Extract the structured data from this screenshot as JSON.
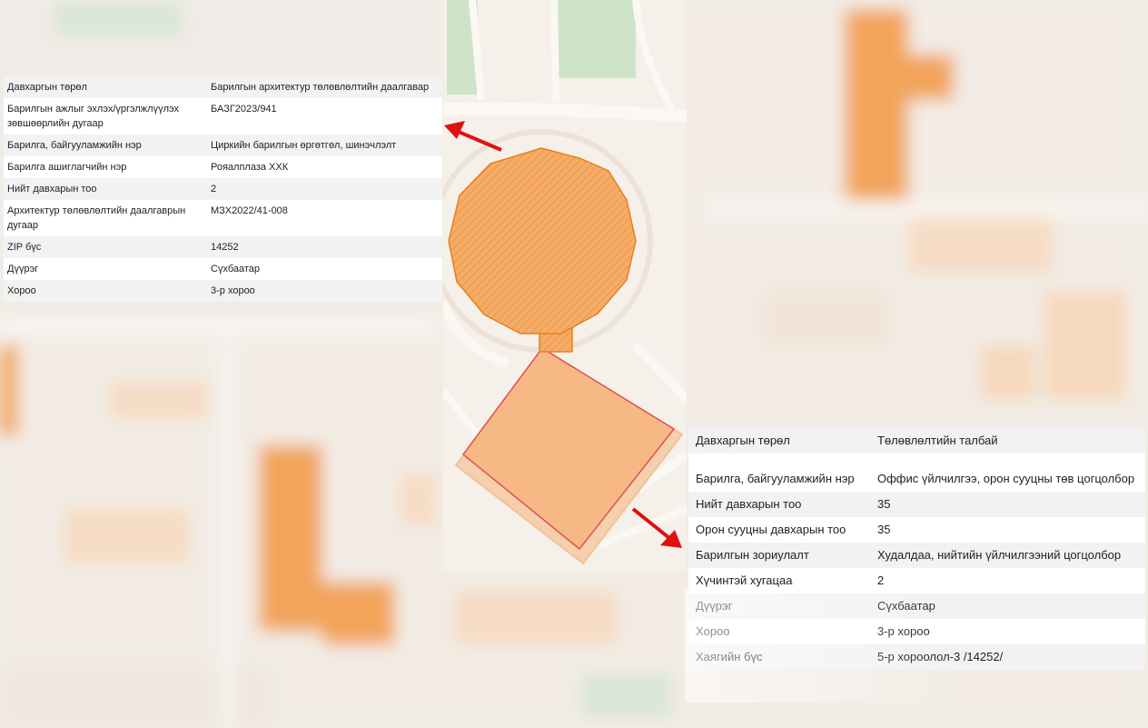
{
  "colors": {
    "building": "#f5a55a",
    "building_outline": "#e8801c",
    "site_outline": "#e05050",
    "arrow": "#e01010",
    "park": "#cfe3c9",
    "road": "#fbf8f4"
  },
  "left_table": {
    "rows": [
      {
        "key": "Давхаргын төрөл",
        "value": "Барилгын архитектур төлөвлөлтийн даалгавар"
      },
      {
        "key": "Барилгын ажлыг эхлэх/үргэлжлүүлэх зөвшөөрлийн дугаар",
        "value": "БАЗГ2023/941"
      },
      {
        "key": "Барилга, байгууламжийн нэр",
        "value": "Циркийн барилгын өргөтгөл, шинэчлэлт"
      },
      {
        "key": "Барилга ашиглагчийн нэр",
        "value": "Рояалплаза ХХК"
      },
      {
        "key": "Нийт давхарын тоо",
        "value": "2"
      },
      {
        "key": "Архитектур төлөвлөлтийн даалгаврын дугаар",
        "value": "МЗХ2022/41-008"
      },
      {
        "key": "ZIP бүс",
        "value": "14252"
      },
      {
        "key": "Дүүрэг",
        "value": "Сүхбаатар"
      },
      {
        "key": "Хороо",
        "value": "3-р хороо"
      }
    ]
  },
  "right_table": {
    "rows": [
      {
        "key": "Давхаргын төрөл",
        "value": "Төлөвлөлтийн талбай"
      },
      {
        "key": "",
        "value": ""
      },
      {
        "key": "Барилга, байгууламжийн нэр",
        "value": "Оффис үйлчилгээ, орон сууцны төв цогцолбор"
      },
      {
        "key": "Нийт давхарын тоо",
        "value": "35"
      },
      {
        "key": "Орон сууцны давхарын тоо",
        "value": "35"
      },
      {
        "key": "Барилгын зориулалт",
        "value": "Худалдаа, нийтийн үйлчилгээний цогцолбор"
      },
      {
        "key": "Хүчинтэй хугацаа",
        "value": "2"
      },
      {
        "key": "Дүүрэг",
        "value": "Сүхбаатар"
      },
      {
        "key": "Хороо",
        "value": "3-р хороо"
      },
      {
        "key": "Хаягийн бүс",
        "value": "5-р хороолол-3 /14252/"
      }
    ]
  }
}
